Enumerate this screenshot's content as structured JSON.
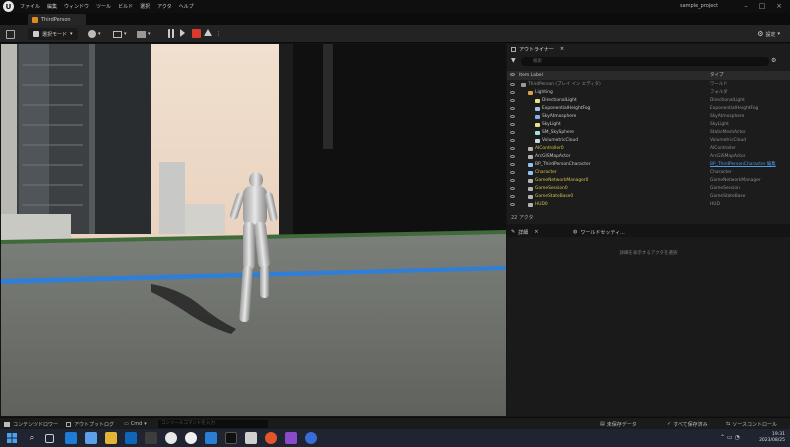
{
  "menubar": {
    "items": [
      "ファイル",
      "編集",
      "ウィンドウ",
      "ツール",
      "ビルド",
      "選択",
      "アクタ",
      "ヘルプ"
    ],
    "project": "sample_project"
  },
  "tabbar": {
    "level": "ThirdPerson"
  },
  "toolbar": {
    "mode": "選択モード",
    "settings": "設定"
  },
  "outliner": {
    "tab": "アウトライナー",
    "search_placeholder": "検索",
    "col_label": "Item Label",
    "col_type": "タイプ",
    "rows": [
      {
        "name": "ThirdPerson (プレイ イン エディタ)",
        "type": "ワールド",
        "depth": 0,
        "icon": "level-icon",
        "color": "#8d8d8d"
      },
      {
        "name": "Lighting",
        "type": "フォルダ",
        "depth": 1,
        "icon": "folder-icon",
        "color": "#c8c8c8"
      },
      {
        "name": "DirectionalLight",
        "type": "DirectionalLight",
        "depth": 2,
        "icon": "light-icon",
        "color": "#c8c8c8"
      },
      {
        "name": "ExponentialHeightFog",
        "type": "ExponentialHeightFog",
        "depth": 2,
        "icon": "fog-icon",
        "color": "#c8c8c8"
      },
      {
        "name": "SkyAtmosphere",
        "type": "SkyAtmosphere",
        "depth": 2,
        "icon": "sky-icon",
        "color": "#c8c8c8"
      },
      {
        "name": "SkyLight",
        "type": "SkyLight",
        "depth": 2,
        "icon": "light-icon",
        "color": "#c8c8c8"
      },
      {
        "name": "SM_SkySphere",
        "type": "StaticMeshActor",
        "depth": 2,
        "icon": "mesh-icon",
        "color": "#c8c8c8"
      },
      {
        "name": "VolumetricCloud",
        "type": "VolumetricCloud",
        "depth": 2,
        "icon": "cloud-icon",
        "color": "#c8c8c8"
      },
      {
        "name": "AIController0",
        "type": "AIController",
        "depth": 1,
        "icon": "actor-icon",
        "color": "#d4c04a"
      },
      {
        "name": "ArcGISMapActor",
        "type": "ArcGISMapActor",
        "depth": 1,
        "icon": "actor-icon",
        "color": "#c8c8c8"
      },
      {
        "name": "BP_ThirdPersonCharacter",
        "type": "BP_ThirdPersonCharacter 編集",
        "depth": 1,
        "icon": "pawn-icon",
        "color": "#c8c8c8",
        "type_link": true
      },
      {
        "name": "Character",
        "type": "Character",
        "depth": 1,
        "icon": "pawn-icon",
        "color": "#d4c04a"
      },
      {
        "name": "GameNetworkManager0",
        "type": "GameNetworkManager",
        "depth": 1,
        "icon": "actor-icon",
        "color": "#d4c04a"
      },
      {
        "name": "GameSession0",
        "type": "GameSession",
        "depth": 1,
        "icon": "actor-icon",
        "color": "#d4c04a"
      },
      {
        "name": "GameStateBase0",
        "type": "GameStateBase",
        "depth": 1,
        "icon": "actor-icon",
        "color": "#d4c04a"
      },
      {
        "name": "HUD0",
        "type": "HUD",
        "depth": 1,
        "icon": "actor-icon",
        "color": "#d4c04a"
      }
    ],
    "count": "22 アクタ"
  },
  "details": {
    "tab1": "詳細",
    "tab2": "ワールドセッティ...",
    "hint": "詳細を表示するアクタを選択"
  },
  "bottombar": {
    "content_drawer": "コンテンツドロワー",
    "output_log": "アウトプットログ",
    "cmd": "Cmd",
    "cmd_placeholder": "コンソールコマンドを入力",
    "unsaved": "未保存データ",
    "save_all": "すべて保存済み",
    "source_control": "ソースコントロール"
  },
  "taskbar": {
    "time": "19:31",
    "date": "2023/08/25"
  },
  "colors": {
    "accent": "#2f7fd8",
    "record": "#d93a2b",
    "play": "#3aa64a"
  }
}
